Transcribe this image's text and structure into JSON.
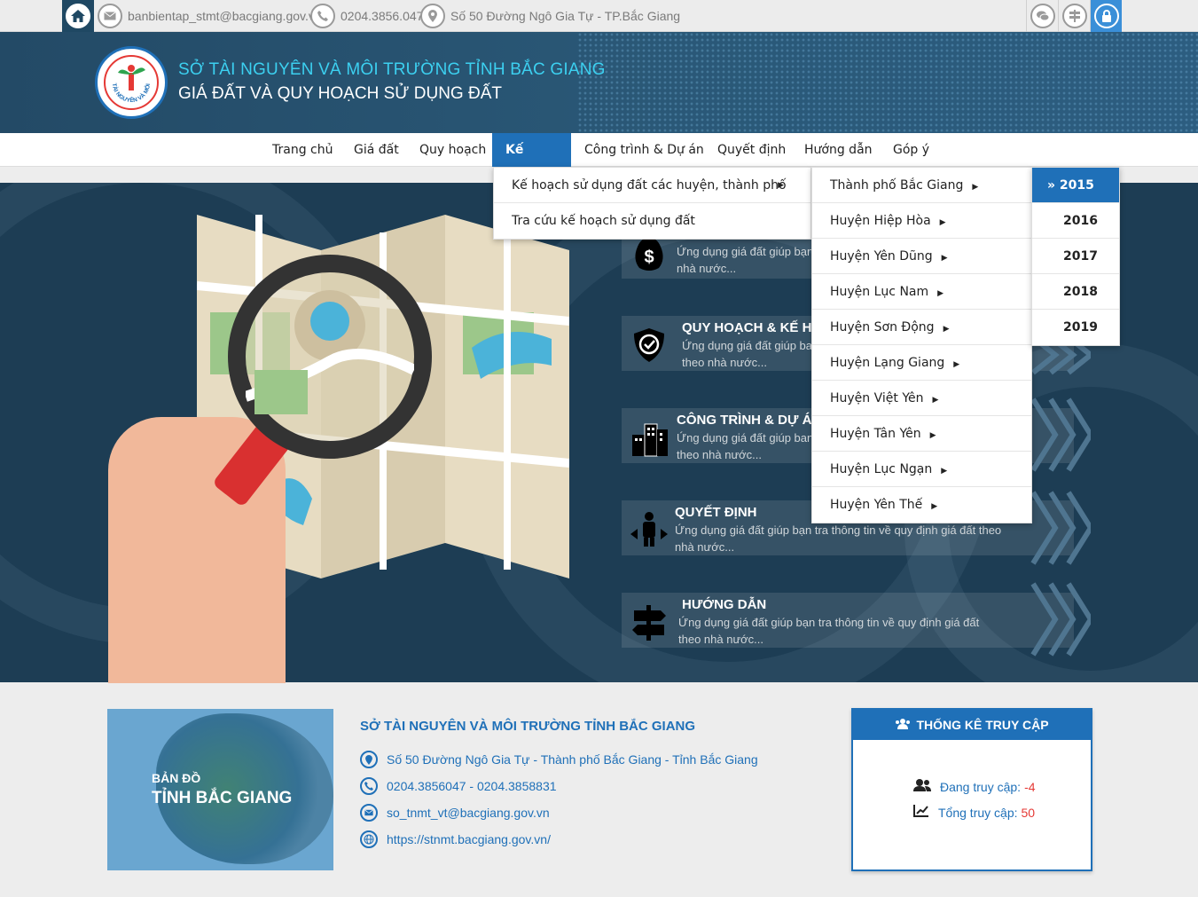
{
  "topbar": {
    "email": "banbientap_stmt@bacgiang.gov.vn",
    "phone": "0204.3856.047",
    "address": "Số 50 Đường Ngô Gia Tự - TP.Bắc Giang"
  },
  "header": {
    "org_name": "SỞ TÀI NGUYÊN VÀ MÔI TRƯỜNG TỈNH BẮC GIANG",
    "site_title": "GIÁ ĐẤT VÀ QUY HOẠCH SỬ DỤNG ĐẤT",
    "logo_text": "TÀI NGUYÊN VÀ MÔI TRƯỜNG"
  },
  "nav": {
    "items": [
      {
        "label": "Trang chủ"
      },
      {
        "label": "Giá đất"
      },
      {
        "label": "Quy hoạch"
      },
      {
        "label": "Kế hoạch",
        "active": true
      },
      {
        "label": "Công trình & Dự án"
      },
      {
        "label": "Quyết định"
      },
      {
        "label": "Hướng dẫn"
      },
      {
        "label": "Góp ý"
      }
    ]
  },
  "dropdown": {
    "level1": [
      "Kế hoạch sử dụng đất các huyện, thành phố",
      "Tra cứu kế hoạch sử dụng đất"
    ],
    "level2": [
      "Thành phố Bắc Giang",
      "Huyện Hiệp Hòa",
      "Huyện Yên Dũng",
      "Huyện Lục Nam",
      "Huyện Sơn Động",
      "Huyện Lạng Giang",
      "Huyện Việt Yên",
      "Huyện Tân Yên",
      "Huyện Lục Ngạn",
      "Huyện Yên Thế"
    ],
    "level3": [
      "2015",
      "2016",
      "2017",
      "2018",
      "2019"
    ]
  },
  "features": [
    {
      "title": "",
      "desc1": "Ứng dụng giá đất giúp bạn",
      "desc2": "nhà nước...",
      "icon": "dollar-icon"
    },
    {
      "title": "QUY HOẠCH & KẾ H",
      "desc1": "Ứng dụng giá đất giúp ba",
      "desc2": "theo nhà nước...",
      "icon": "shield-check-icon"
    },
    {
      "title": "CÔNG TRÌNH & DỰ Á",
      "desc1": "Ứng dụng giá đất giúp ban",
      "desc2": "theo nhà nước...",
      "icon": "buildings-icon"
    },
    {
      "title": "QUYẾT ĐỊNH",
      "desc1": "Ứng dụng giá đất giúp bạn tra thông tin về quy định giá đất theo",
      "desc2": "nhà nước...",
      "icon": "person-decision-icon"
    },
    {
      "title": "HƯỚNG DẪN",
      "desc1": "Ứng dụng giá đất giúp bạn tra thông tin về quy định giá đất",
      "desc2": "theo nhà nước...",
      "icon": "signpost-icon"
    }
  ],
  "footer": {
    "map_line1": "BẢN ĐỒ",
    "map_line2": "TỈNH BẮC GIANG",
    "org_name": "SỞ TÀI NGUYÊN VÀ MÔI TRƯỜNG TỈNH BẮC GIANG",
    "address": "Số 50 Đường Ngô Gia Tự - Thành phố Bắc Giang - Tỉnh Bắc Giang",
    "phone": "0204.3856047 - 0204.3858831",
    "email": "so_tnmt_vt@bacgiang.gov.vn",
    "website": "https://stnmt.bacgiang.gov.vn/"
  },
  "stats": {
    "title": "THỐNG KÊ TRUY CẬP",
    "online_label": "Đang truy cập:",
    "online_value": "-4",
    "total_label": "Tổng truy cập:",
    "total_value": "50"
  },
  "colors": {
    "primary": "#1f70b8",
    "header_bg": "#234a66",
    "hero_bg": "#1d3d54",
    "accent_red": "#e53935",
    "title_cyan": "#3cd0f0"
  }
}
